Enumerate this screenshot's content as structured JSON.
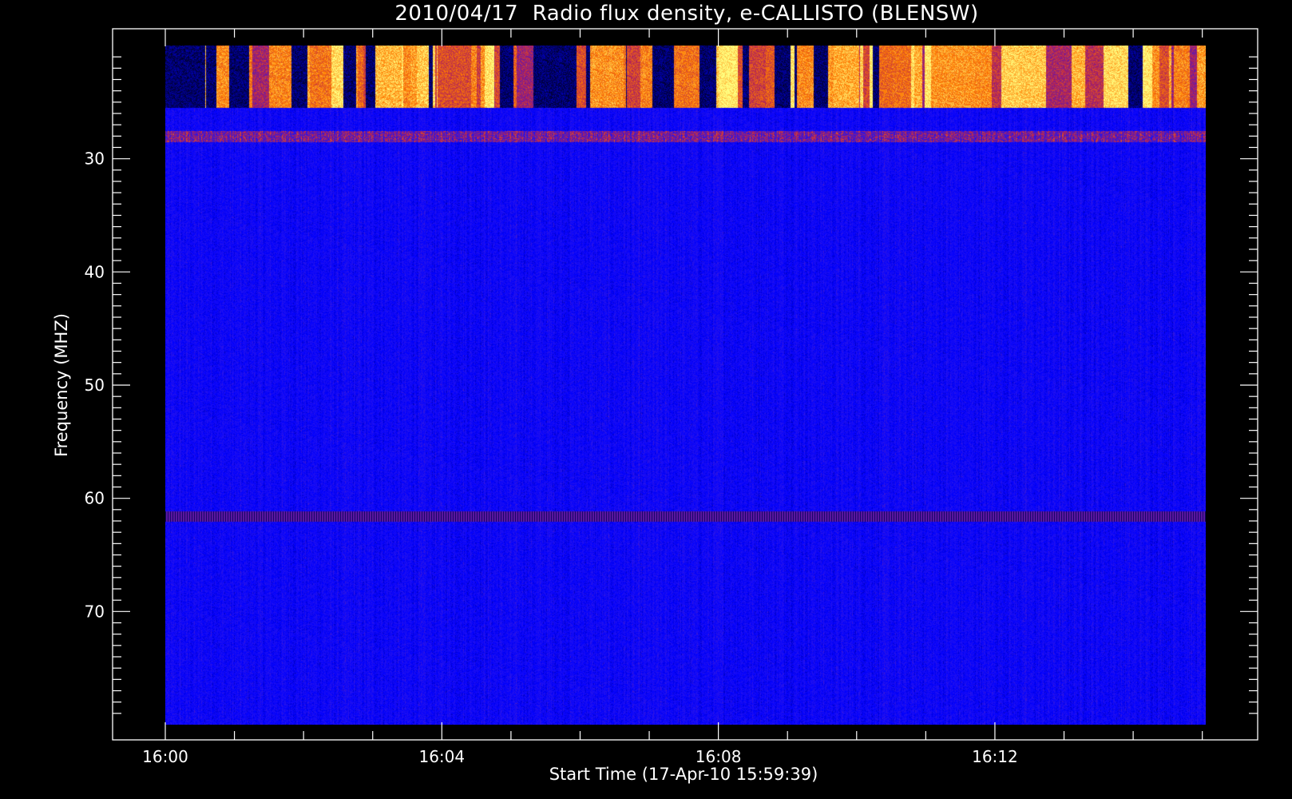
{
  "chart_data": {
    "type": "heatmap",
    "title": "2010/04/17  Radio flux density, e-CALLISTO (BLENSW)",
    "xlabel": "Start Time (17-Apr-10 15:59:39)",
    "ylabel": "Frequency (MHZ)",
    "x_ticks": [
      "16:00",
      "16:04",
      "16:08",
      "16:12"
    ],
    "x_tick_minutes": [
      0,
      4,
      8,
      12
    ],
    "x_range_minutes": [
      -0.75,
      15.8
    ],
    "data_x_range_minutes": [
      0,
      15.05
    ],
    "y_ticks": [
      30,
      40,
      50,
      60,
      70
    ],
    "y_range_mhz": [
      20,
      80
    ],
    "data_y_range_mhz": [
      20,
      80
    ],
    "y_inverted": true,
    "colormap": [
      "#000000",
      "#0000ff",
      "#b0205a",
      "#ff7a00",
      "#ffff80"
    ],
    "features": {
      "intense_top_band_mhz": [
        20.0,
        25.5
      ],
      "bright_emission_line_mhz": 28.0,
      "dark_line_mhz": 61.6
    },
    "colors": {
      "background": "#000000",
      "axes": "#ffffff",
      "text": "#ffffff"
    }
  }
}
